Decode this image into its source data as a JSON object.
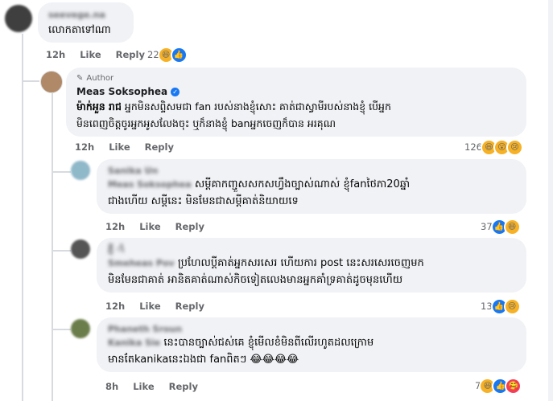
{
  "comments": [
    {
      "name": "seevege.na",
      "text": "លោកតាទៅណា",
      "time": "12h",
      "like_label": "Like",
      "reply_label": "Reply",
      "reaction_count": "22"
    },
    {
      "author_badge": "Author",
      "name": "Meas Soksophea",
      "tag": "ម៉ាក់អួន រាជ",
      "text_line1": "អ្នកមិនសព្ទិសមជា fan របស់នាងខ្ញុំសោះ គាត់ជាស្វាមីរបស់នាងខ្ញុំ បើអ្នក",
      "text_line2": "មិនពេញចិត្តចូរអ្នកអូសលែងចុះ ឬក៏នាងខ្ញុំ banអ្នកចេញក៏បាន អរគុណ",
      "time": "12h",
      "like_label": "Like",
      "reply_label": "Reply",
      "reaction_count": "126"
    },
    {
      "name": "Sanika Un",
      "mention": "Meas Soksophea",
      "text_line1": "សម្តីគាកញ្ជួសសកសហ្វឹងច្បាស់ណាស់ ខ្ញុំfanថៃភា20ឆ្នាំ",
      "text_line2": "ជាងហើយ សម្តីនេះ មិនមែនជាសម្តីគាត់និយាយទេ",
      "time": "12h",
      "like_label": "Like",
      "reply_label": "Reply",
      "reaction_count": "37"
    },
    {
      "name": "ភ្ញី ាំ",
      "mention": "Smeheas Pov",
      "text_line1": "ប្រហែលប្តីគាត់អ្នកសរសេរ ហើយការ post នេះសរសេរចេញមក",
      "text_line2": "មិនមែនជាគាត់ អានិតគាត់ណាស់កិចទៀតលេងមានអ្នកគាំទ្រគាត់ដូចមុនហើយ",
      "time": "12h",
      "like_label": "Like",
      "reply_label": "Reply",
      "reaction_count": "13"
    },
    {
      "name": "Phaneth Sroun",
      "mention": "Kanika Sie",
      "text_line1": "នេះបានច្បាស់ជស់គេ ខ្ញុំមើលខំមិនពីលើរហូតដលក្រោម",
      "text_line2": "មានតែkanikaនេះឯងជា fanពិតៗ 😂😂😂😂",
      "time": "8h",
      "like_label": "Like",
      "reply_label": "Reply",
      "reaction_count": "7"
    }
  ],
  "icons": {
    "like": "👍",
    "haha": "😆",
    "wow": "😮",
    "sad": "😢",
    "care": "🥰",
    "pen": "✎",
    "check": "✓"
  },
  "colors": {
    "bubble": "#f0f2f5",
    "meta": "#65676b",
    "like_blue": "#1877f2"
  }
}
